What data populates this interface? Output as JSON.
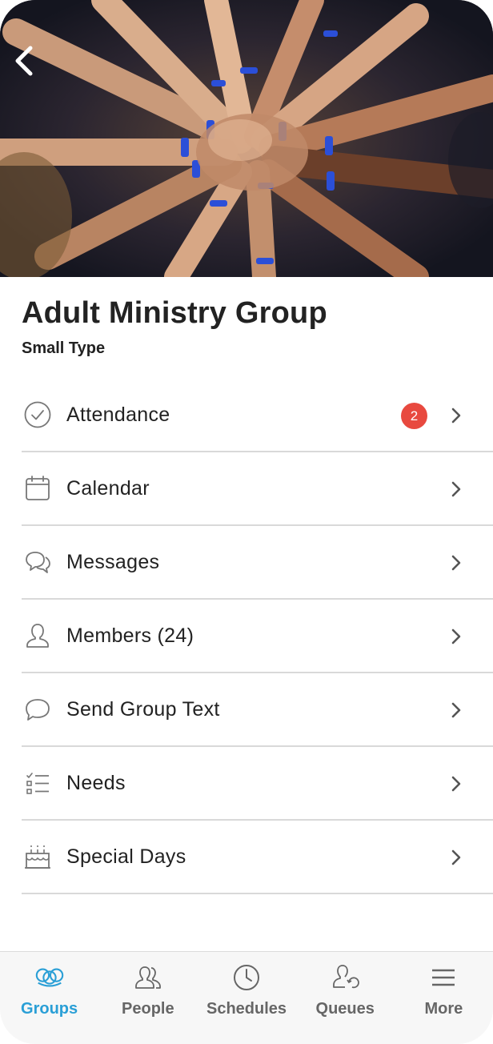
{
  "group": {
    "title": "Adult Ministry Group",
    "type": "Small Type"
  },
  "menu": [
    {
      "label": "Attendance",
      "icon": "check-circle-icon",
      "badge": "2"
    },
    {
      "label": "Calendar",
      "icon": "calendar-icon"
    },
    {
      "label": "Messages",
      "icon": "messages-icon"
    },
    {
      "label": "Members (24)",
      "icon": "person-icon"
    },
    {
      "label": "Send Group Text",
      "icon": "speech-bubble-icon"
    },
    {
      "label": "Needs",
      "icon": "checklist-icon"
    },
    {
      "label": "Special Days",
      "icon": "cake-icon"
    }
  ],
  "tabs": [
    {
      "label": "Groups",
      "icon": "groups-icon",
      "active": true
    },
    {
      "label": "People",
      "icon": "people-icon"
    },
    {
      "label": "Schedules",
      "icon": "clock-icon"
    },
    {
      "label": "Queues",
      "icon": "queues-icon"
    },
    {
      "label": "More",
      "icon": "menu-icon"
    }
  ],
  "colors": {
    "accent": "#2a9fd6",
    "badge": "#e8493f",
    "divider": "#d9d9d9"
  }
}
